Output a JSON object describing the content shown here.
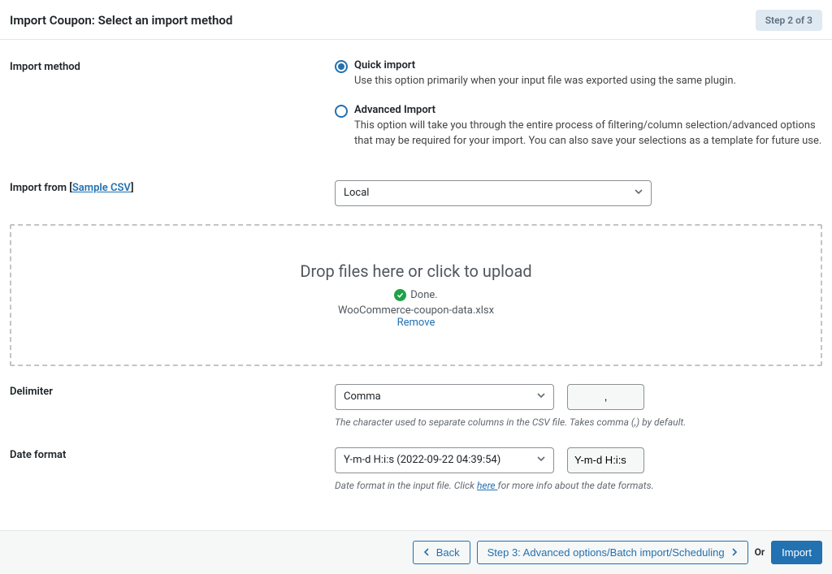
{
  "header": {
    "title": "Import Coupon: Select an import method",
    "step": "Step 2 of 3"
  },
  "sections": {
    "method": {
      "label": "Import method",
      "quick": {
        "title": "Quick import",
        "desc": "Use this option primarily when your input file was exported using the same plugin."
      },
      "advanced": {
        "title": "Advanced Import",
        "desc": "This option will take you through the entire process of filtering/column selection/advanced options that may be required for your import. You can also save your selections as a template for future use."
      }
    },
    "from": {
      "label_pre": "Import from [",
      "sample": "Sample CSV",
      "label_post": "]",
      "value": "Local"
    },
    "dropzone": {
      "title": "Drop files here or click to upload",
      "done": "Done.",
      "file": "WooCommerce-coupon-data.xlsx",
      "remove": "Remove"
    },
    "delimiter": {
      "label": "Delimiter",
      "value": "Comma",
      "symbol": ",",
      "help": "The character used to separate columns in the CSV file. Takes comma (,) by default."
    },
    "dateformat": {
      "label": "Date format",
      "value": "Y-m-d H:i:s (2022-09-22 04:39:54)",
      "code": "Y-m-d H:i:s",
      "help_pre": "Date format in the input file. Click ",
      "help_link": "here ",
      "help_post": "for more info about the date formats."
    }
  },
  "footer": {
    "back": "Back",
    "next": "Step 3: Advanced options/Batch import/Scheduling",
    "or": "Or",
    "import": "Import"
  }
}
